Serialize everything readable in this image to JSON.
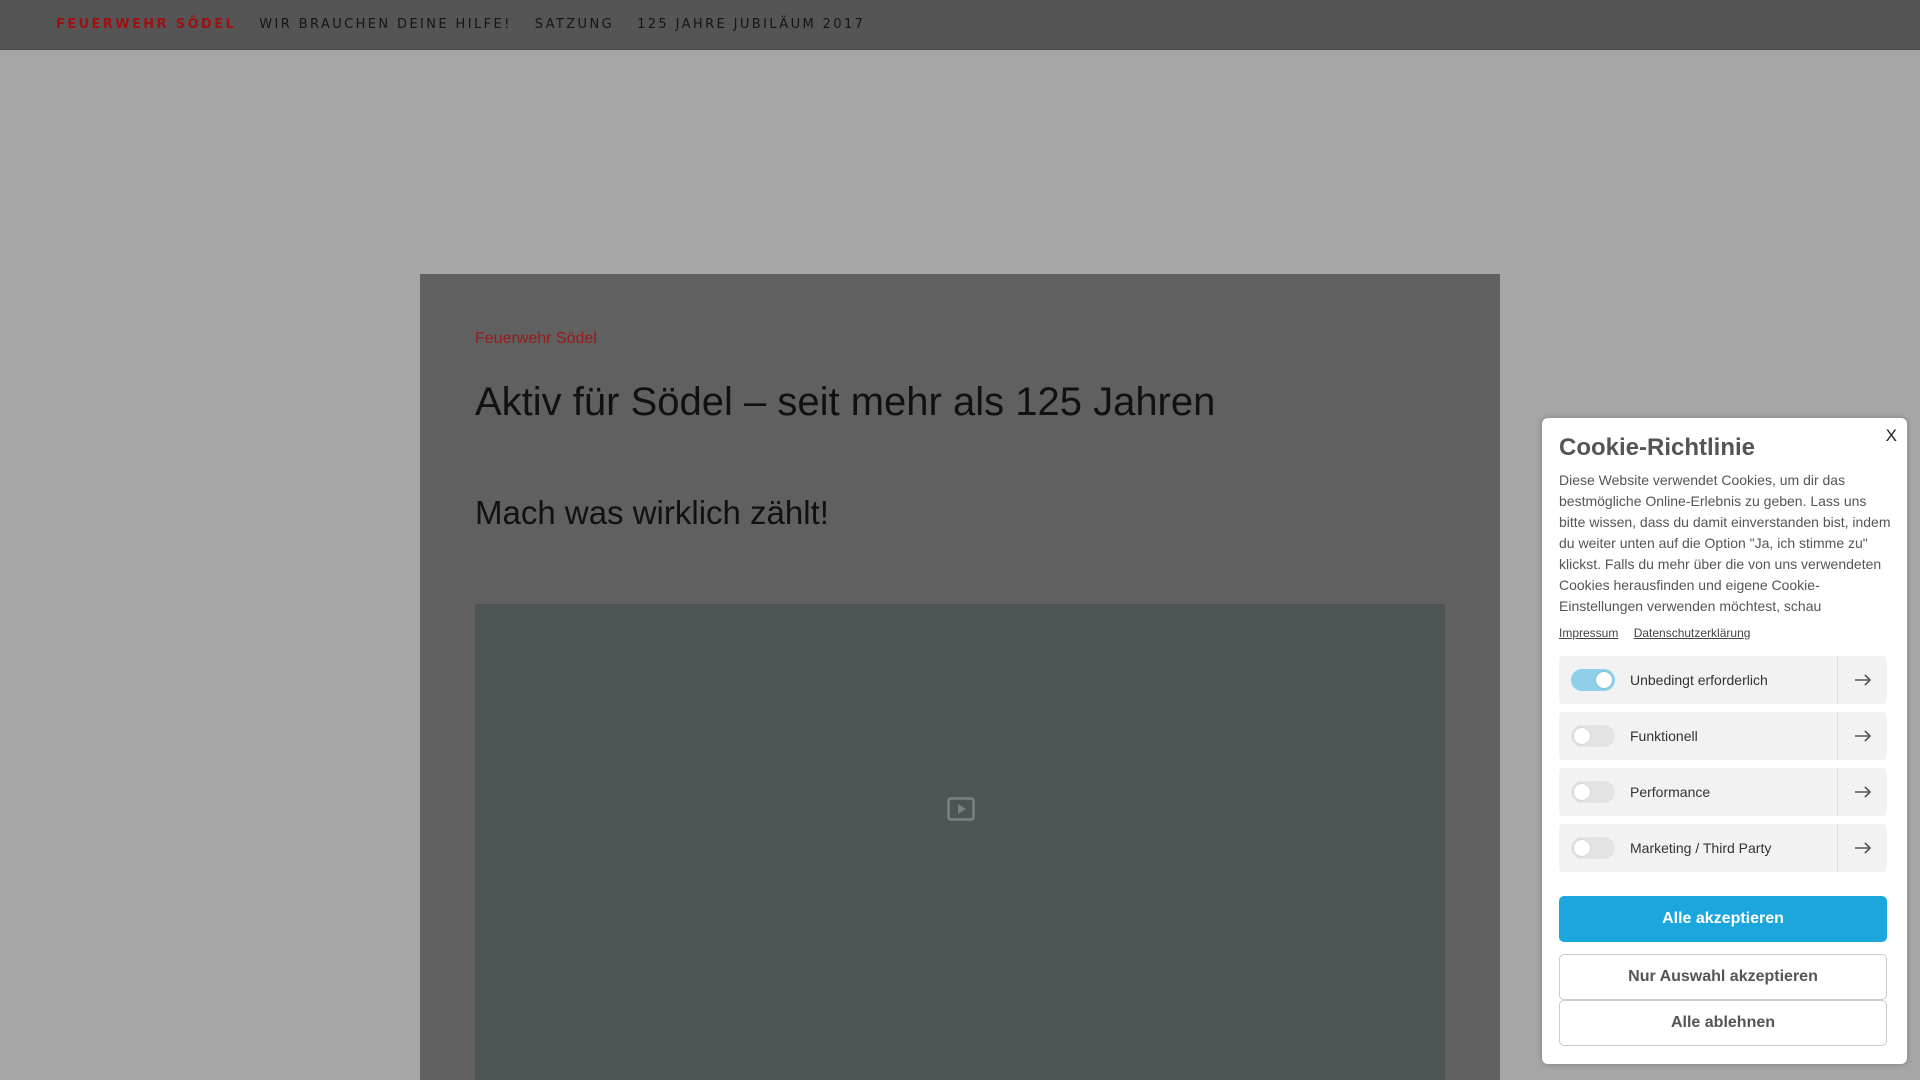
{
  "nav": {
    "items": [
      {
        "label": "FEUERWEHR SÖDEL"
      },
      {
        "label": "WIR BRAUCHEN DEINE HILFE!"
      },
      {
        "label": "SATZUNG"
      },
      {
        "label": "125 JAHRE JUBILÄUM 2017"
      }
    ]
  },
  "main": {
    "kicker": "Feuerwehr Södel",
    "headline": "Aktiv für Södel – seit mehr als 125 Jahren",
    "subhead": "Mach was wirklich zählt!",
    "video_icon": "play-icon"
  },
  "cookie": {
    "close_label": "X",
    "title": "Cookie-Richtlinie",
    "text": "Diese Website verwendet Cookies, um dir das bestmögliche Online-Erlebnis zu geben. Lass uns bitte wissen, dass du damit einverstanden bist, indem du weiter unten auf die Option \"Ja, ich stimme zu\" klickst. Falls du mehr über die von uns verwendeten Cookies herausfinden und eigene Cookie-Einstellungen verwenden möchtest, schau",
    "links": [
      {
        "label": "Impressum"
      },
      {
        "label": "Datenschutzerklärung"
      }
    ],
    "categories": [
      {
        "label": "Unbedingt erforderlich",
        "enabled": true
      },
      {
        "label": "Funktionell",
        "enabled": false
      },
      {
        "label": "Performance",
        "enabled": false
      },
      {
        "label": "Marketing / Third Party",
        "enabled": false
      }
    ],
    "buttons": {
      "accept_all": "Alle akzeptieren",
      "accept_selection": "Nur Auswahl akzeptieren",
      "reject_all": "Alle ablehnen"
    }
  },
  "colors": {
    "accent": "#1ba6de",
    "brand_red": "#a01010",
    "nav_bg": "#555555"
  }
}
